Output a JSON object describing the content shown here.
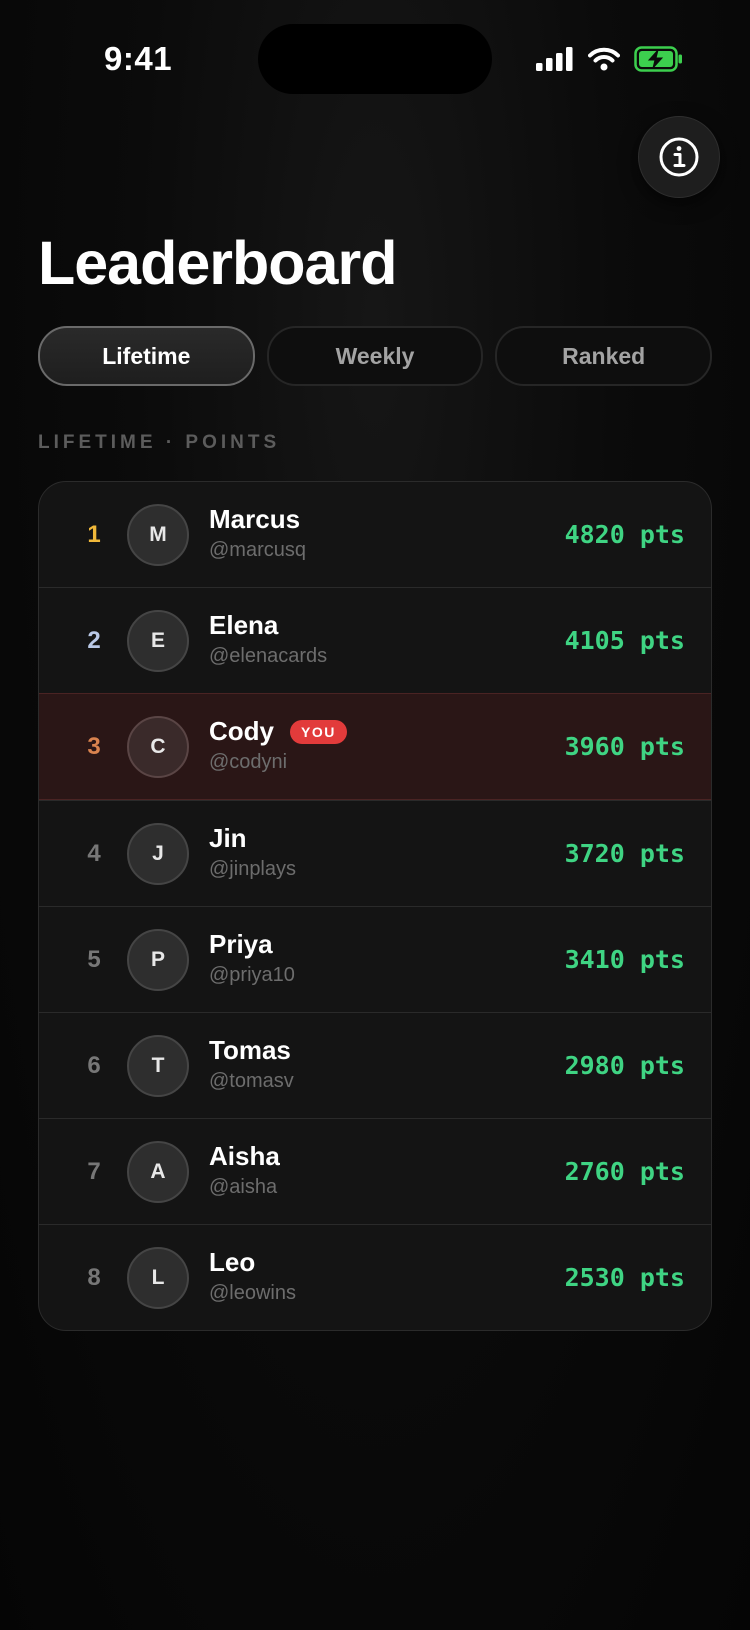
{
  "status_bar": {
    "time": "9:41",
    "icons": [
      "signal-icon",
      "wifi-icon",
      "battery-charging-icon"
    ]
  },
  "header": {
    "info_icon": "info-icon",
    "title": "Leaderboard"
  },
  "tabs": [
    {
      "label": "Lifetime",
      "active": true
    },
    {
      "label": "Weekly",
      "active": false
    },
    {
      "label": "Ranked",
      "active": false
    }
  ],
  "section_label": "LIFETIME · POINTS",
  "you_badge": "YOU",
  "colors": {
    "points": "#3fd483",
    "rank_gold": "#f0b83a",
    "rank_silver": "#b9c8e6",
    "rank_bronze": "#d9834f",
    "rank_default": "#777777",
    "you_highlight": "#2a1616",
    "you_badge": "#e23b3b",
    "battery": "#3ccf4e"
  },
  "entries": [
    {
      "rank": "1",
      "initial": "M",
      "name": "Marcus",
      "handle": "@marcusq",
      "points": "4820 pts",
      "is_you": false
    },
    {
      "rank": "2",
      "initial": "E",
      "name": "Elena",
      "handle": "@elenacards",
      "points": "4105 pts",
      "is_you": false
    },
    {
      "rank": "3",
      "initial": "C",
      "name": "Cody",
      "handle": "@codyni",
      "points": "3960 pts",
      "is_you": true
    },
    {
      "rank": "4",
      "initial": "J",
      "name": "Jin",
      "handle": "@jinplays",
      "points": "3720 pts",
      "is_you": false
    },
    {
      "rank": "5",
      "initial": "P",
      "name": "Priya",
      "handle": "@priya10",
      "points": "3410 pts",
      "is_you": false
    },
    {
      "rank": "6",
      "initial": "T",
      "name": "Tomas",
      "handle": "@tomasv",
      "points": "2980 pts",
      "is_you": false
    },
    {
      "rank": "7",
      "initial": "A",
      "name": "Aisha",
      "handle": "@aisha",
      "points": "2760 pts",
      "is_you": false
    },
    {
      "rank": "8",
      "initial": "L",
      "name": "Leo",
      "handle": "@leowins",
      "points": "2530 pts",
      "is_you": false
    }
  ]
}
